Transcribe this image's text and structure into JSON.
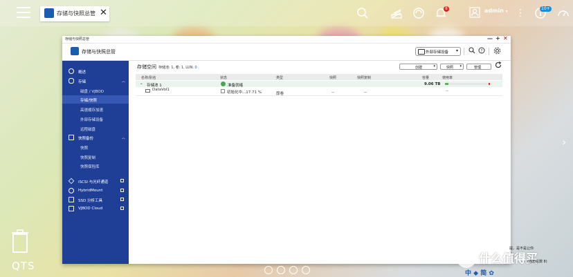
{
  "desktop": {
    "os_label": "QTS",
    "watermark_text": "什么值得买",
    "bottom_logo_text": "中 ◆ 简 ✿",
    "notification_line1": "提，是不是让你",
    "notification_line2": "(通知总数 8)"
  },
  "taskbar": {
    "app_tab_title": "存储与快照总管",
    "app_tab_close": "✕",
    "notification_badge": "8",
    "user_name": "admin",
    "user_chevron": "▾",
    "info_badge": "10+"
  },
  "window": {
    "title": "存储与快照总管",
    "minimize": "—",
    "maximize": "+",
    "close": "✕",
    "app_title": "存储与快照总管",
    "external_storage_label": "外部存储设备",
    "external_storage_arrow": "▾"
  },
  "sidebar": {
    "items": [
      {
        "label": "概述"
      },
      {
        "label": "存储"
      },
      {
        "label": "磁盘 / VJBOD"
      },
      {
        "label": "存储/快照"
      },
      {
        "label": "高速缓存加速"
      },
      {
        "label": "外部存储设备"
      },
      {
        "label": "远程磁盘"
      },
      {
        "label": "快照备份"
      },
      {
        "label": "快照"
      },
      {
        "label": "快照复制"
      },
      {
        "label": "快照保险库"
      },
      {
        "label": "iSCSI 与光纤通道"
      },
      {
        "label": "HybridMount"
      },
      {
        "label": "SSD 分析工具"
      },
      {
        "label": "VJBOD Cloud"
      }
    ]
  },
  "main": {
    "title": "存储空间",
    "subtitle_prefix": "存储池: 1, 卷: 1, LUN: ",
    "subtitle_lun": "0",
    "buttons": {
      "create": "创建",
      "snapshot": "快照",
      "manage": "管理",
      "arrow": "▾"
    },
    "columns": [
      "名称/别名",
      "状态",
      "类型",
      "快照",
      "快照复制",
      "容量",
      "使用率"
    ],
    "pool_row": {
      "name": "存储池 1",
      "status": "准备就绪",
      "capacity": "9.06 TB",
      "usage_fraction": 0.08
    },
    "volume_row": {
      "name": "DataVol1",
      "status": "初始化中...17.71 %",
      "type": "厚卷",
      "snapshot": "--",
      "snapshot_replica": "--",
      "usage": "--"
    }
  }
}
